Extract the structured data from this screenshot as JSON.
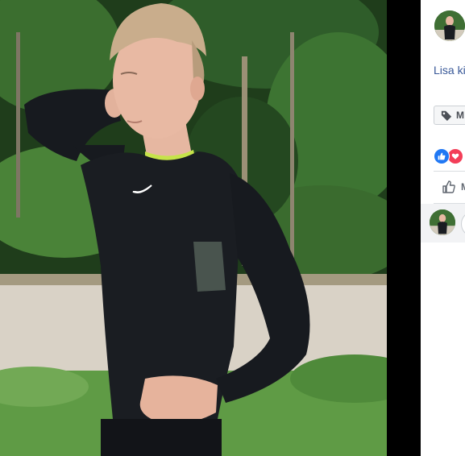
{
  "photo": {
    "alt": "photo",
    "logo_text": "",
    "colors": {
      "background": "#000000",
      "foliage": "#2f5d2a",
      "road": "#d9d2c6",
      "grass": "#5f9b45",
      "shirt": "#1a1d22",
      "skin": "#e8b9a3",
      "hair": "#c9ad8c",
      "collar": "#c6e34a"
    }
  },
  "panel": {
    "caption": "Lisa ki",
    "tag_button_label": "M",
    "tag_icon": "tag-icon",
    "reactions": [
      "like",
      "love"
    ],
    "like_action_label": "M",
    "like_icon": "thumbs-up-icon",
    "link_color": "#385898",
    "like_color": "#2078f4",
    "love_color": "#f33e58"
  }
}
